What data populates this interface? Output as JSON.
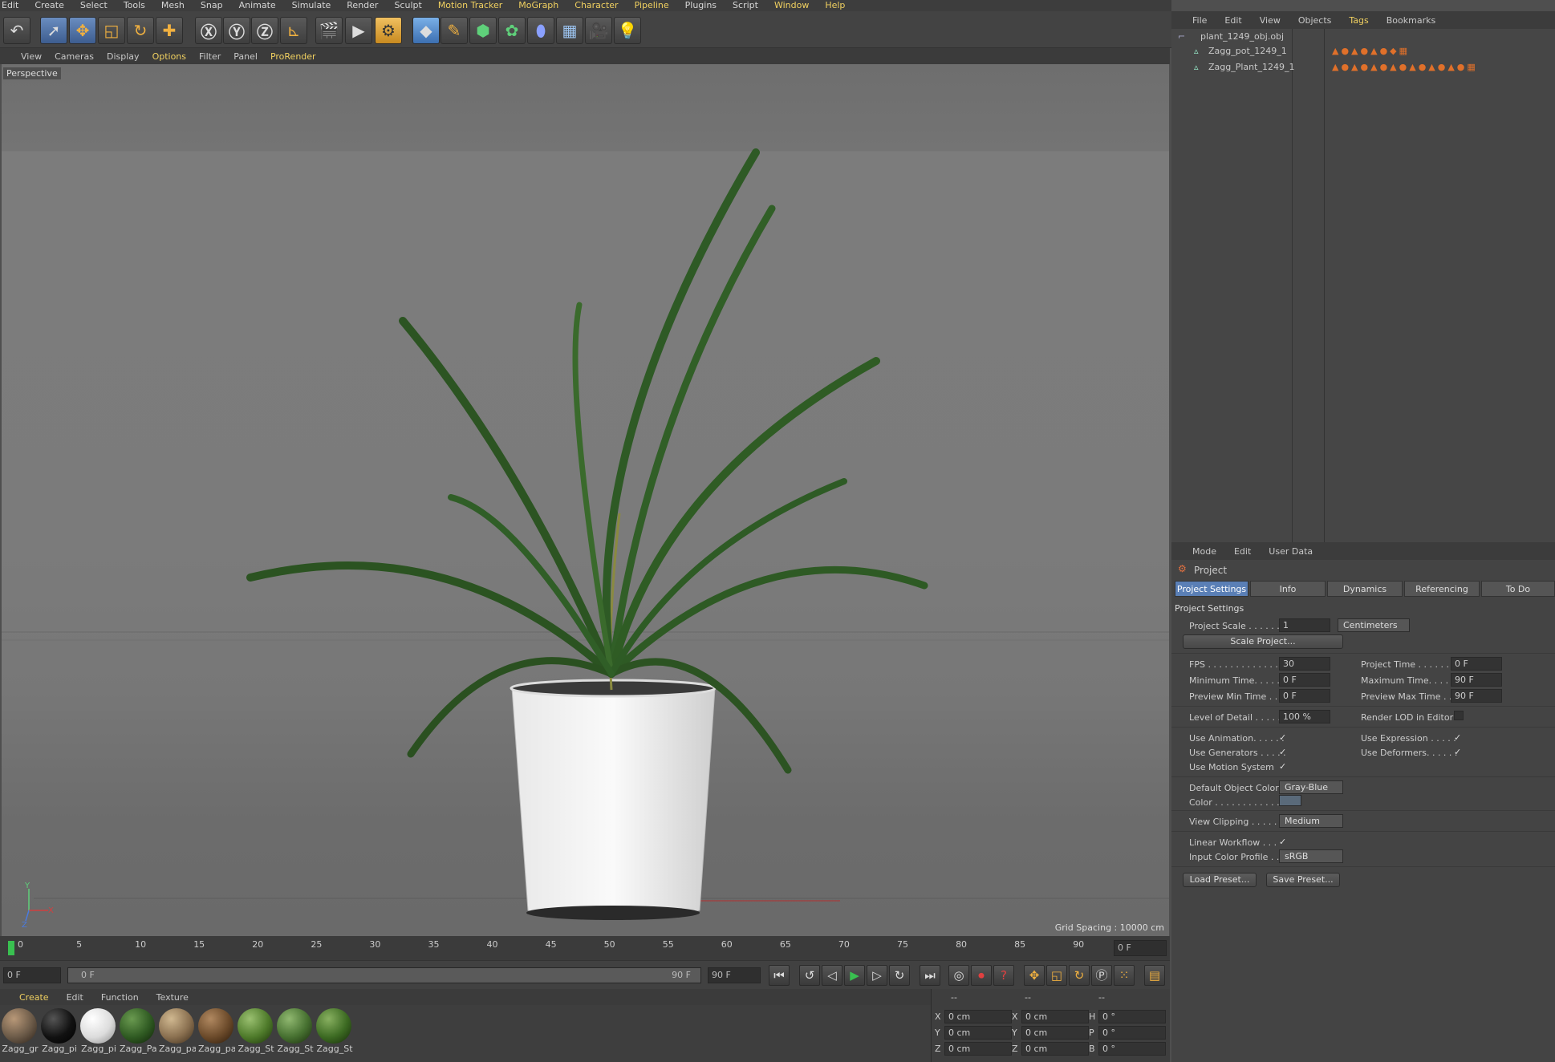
{
  "menubar": [
    "Edit",
    "Create",
    "Select",
    "Tools",
    "Mesh",
    "Snap",
    "Animate",
    "Simulate",
    "Render",
    "Sculpt",
    "Motion Tracker",
    "MoGraph",
    "Character",
    "Pipeline",
    "Plugins",
    "Script",
    "Window",
    "Help"
  ],
  "viewport_menu": [
    "View",
    "Cameras",
    "Display",
    "Options",
    "Filter",
    "Panel",
    "ProRender"
  ],
  "viewport": {
    "label": "Perspective",
    "grid_spacing": "Grid Spacing : 10000 cm",
    "axis_x": "X",
    "axis_y": "Y",
    "axis_z": "Z"
  },
  "toolbar_icons": [
    "undo-icon",
    "select-icon",
    "move-icon",
    "scale-icon",
    "rotate-icon",
    "transform-icon",
    "x-axis-icon",
    "y-axis-icon",
    "z-axis-icon",
    "coordinate-system-icon",
    "render-view-icon",
    "render-picture-viewer-icon",
    "render-settings-icon",
    "cube-icon",
    "pen-icon",
    "subdivision-icon",
    "mograph-cloner-icon",
    "deformer-icon",
    "floor-icon",
    "camera-icon",
    "light-icon"
  ],
  "timeline": {
    "ticks": [
      "0",
      "5",
      "10",
      "15",
      "20",
      "25",
      "30",
      "35",
      "40",
      "45",
      "50",
      "55",
      "60",
      "65",
      "70",
      "75",
      "80",
      "85",
      "90"
    ],
    "current_frame": "0 F",
    "start": "0 F",
    "range_start": "0 F",
    "range_end": "90 F",
    "end": "90 F"
  },
  "material_menu": [
    "Create",
    "Edit",
    "Function",
    "Texture"
  ],
  "materials": [
    {
      "name": "Zagg_gr",
      "color": "#6b5a48"
    },
    {
      "name": "Zagg_pi",
      "color": "#111111"
    },
    {
      "name": "Zagg_pi",
      "color": "#e6e6e6"
    },
    {
      "name": "Zagg_Pa",
      "color": "#2f5a22"
    },
    {
      "name": "Zagg_pa",
      "color": "#8a7050"
    },
    {
      "name": "Zagg_pa",
      "color": "#6b4a2a"
    },
    {
      "name": "Zagg_St",
      "color": "#4e7a2a"
    },
    {
      "name": "Zagg_St",
      "color": "#467030"
    },
    {
      "name": "Zagg_St",
      "color": "#3c6a22"
    }
  ],
  "coords": {
    "headers": [
      "--",
      "--",
      "--"
    ],
    "rows": [
      {
        "a": "X",
        "av": "0 cm",
        "b": "X",
        "bv": "0 cm",
        "c": "H",
        "cv": "0 °"
      },
      {
        "a": "Y",
        "av": "0 cm",
        "b": "Y",
        "bv": "0 cm",
        "c": "P",
        "cv": "0 °"
      },
      {
        "a": "Z",
        "av": "0 cm",
        "b": "Z",
        "bv": "0 cm",
        "c": "B",
        "cv": "0 °"
      }
    ]
  },
  "object_menu": [
    "File",
    "Edit",
    "View",
    "Objects",
    "Tags",
    "Bookmarks"
  ],
  "objects": [
    {
      "name": "plant_1249_obj.obj",
      "indent": 0
    },
    {
      "name": "Zagg_pot_1249_1",
      "indent": 1
    },
    {
      "name": "Zagg_Plant_1249_1",
      "indent": 1
    }
  ],
  "attr_menu": [
    "Mode",
    "Edit",
    "User Data"
  ],
  "attr": {
    "title": "Project",
    "tabs": [
      "Project Settings",
      "Info",
      "Dynamics",
      "Referencing",
      "To Do"
    ],
    "section": "Project Settings",
    "project_scale_label": "Project Scale . . . . . .",
    "project_scale": "1",
    "project_scale_unit": "Centimeters",
    "scale_project_btn": "Scale Project...",
    "fps_label": "FPS . . . . . . . . . . . . . .",
    "fps": "30",
    "project_time_label": "Project Time . . . . . . . .",
    "project_time": "0 F",
    "min_time_label": "Minimum Time. . . . . . .",
    "min_time": "0 F",
    "max_time_label": "Maximum Time. . . . . .",
    "max_time": "90 F",
    "prev_min_label": "Preview Min Time . . .",
    "prev_min": "0 F",
    "prev_max_label": "Preview Max Time . . .",
    "prev_max": "90 F",
    "lod_label": "Level of Detail . . . . .",
    "lod": "100 %",
    "render_lod_label": "Render LOD in Editor",
    "use_anim_label": "Use Animation. . . . . .",
    "use_expr_label": "Use Expression . . . . .",
    "use_gen_label": "Use Generators . . . . .",
    "use_def_label": "Use Deformers. . . . . .",
    "use_motion_label": "Use Motion System",
    "def_obj_color_label": "Default Object Color",
    "def_obj_color": "Gray-Blue",
    "color_label": "Color . . . . . . . . . . . .",
    "view_clip_label": "View Clipping . . . . .",
    "view_clip": "Medium",
    "linear_wf_label": "Linear Workflow . . .",
    "input_profile_label": "Input Color Profile . .",
    "input_profile": "sRGB",
    "load_preset": "Load Preset...",
    "save_preset": "Save Preset...",
    "check": "✓"
  }
}
